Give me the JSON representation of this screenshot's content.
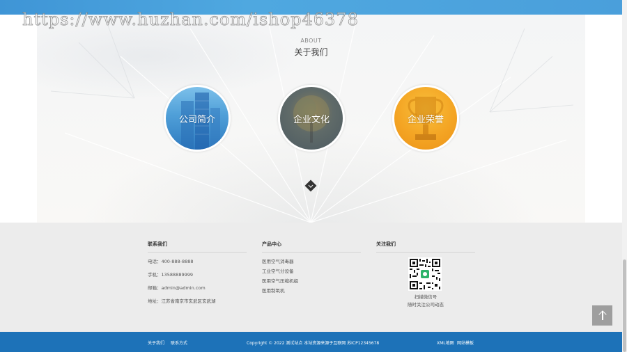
{
  "watermark": "https://www.huzhan.com/ishop46378",
  "about": {
    "en": "ABOUT",
    "zh": "关于我们",
    "items": [
      {
        "label": "公司简介"
      },
      {
        "label": "企业文化"
      },
      {
        "label": "企业荣誉"
      }
    ],
    "more_icon": "diamond-arrow-icon"
  },
  "footer": {
    "contact": {
      "title": "联系我们",
      "lines": [
        "电话：400-888-8888",
        "手机：13588889999",
        "邮箱：admin@admin.com",
        "地址：江苏省南京市玄武区玄武湖"
      ]
    },
    "products": {
      "title": "产品中心",
      "items": [
        "医用空气消毒器",
        "工业空气分设备",
        "医用空气压缩机组",
        "医用制氧机"
      ]
    },
    "follow": {
      "title": "关注我们",
      "caption1": "扫描微信号",
      "caption2": "随时关注公司动态"
    }
  },
  "bottom": {
    "link_about": "关于我们",
    "link_contact": "联系方式",
    "copyright": "Copyright © 2022 测试站点 本站资源来源于互联网   苏ICP12345678",
    "link_sitemap": "XML地图",
    "link_template": "网站模板"
  },
  "colors": {
    "top_bar": "#4a9fdb",
    "footer_bg": "#ececec",
    "bottom_bar": "#1d72b8"
  }
}
